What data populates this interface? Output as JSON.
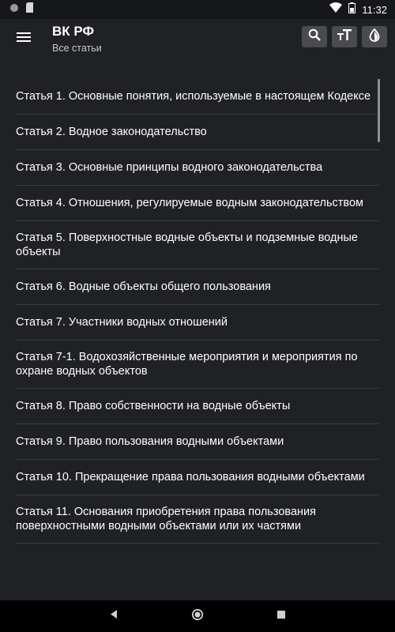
{
  "status_bar": {
    "time": "11:32",
    "icons_left": [
      "notification-dot-icon",
      "sd-card-icon"
    ],
    "icons_right": [
      "wifi-icon",
      "battery-icon"
    ]
  },
  "app_bar": {
    "title": "ВК РФ",
    "subtitle": "Все статьи",
    "actions": [
      "search-icon",
      "text-size-icon",
      "theme-drop-icon"
    ]
  },
  "articles": [
    "Статья 1. Основные понятия, используемые в настоящем Кодексе",
    "Статья 2. Водное законодательство",
    "Статья 3. Основные принципы водного законодательства",
    "Статья 4. Отношения, регулируемые водным законодательством",
    "Статья 5. Поверхностные водные объекты и подземные водные объекты",
    "Статья 6. Водные объекты общего пользования",
    "Статья 7. Участники водных отношений",
    "Статья 7-1. Водохозяйственные мероприятия и мероприятия по охране водных объектов",
    "Статья 8. Право собственности на водные объекты",
    "Статья 9. Право пользования водными объектами",
    "Статья 10. Прекращение права пользования водными объектами",
    "Статья 11. Основания приобретения права пользования поверхностными водными объектами или их частями"
  ],
  "colors": {
    "background": "#202124",
    "status_bar": "#16171a",
    "action_button": "#4a4b4f",
    "divider": "#3a3b3e",
    "text": "#ffffff"
  }
}
